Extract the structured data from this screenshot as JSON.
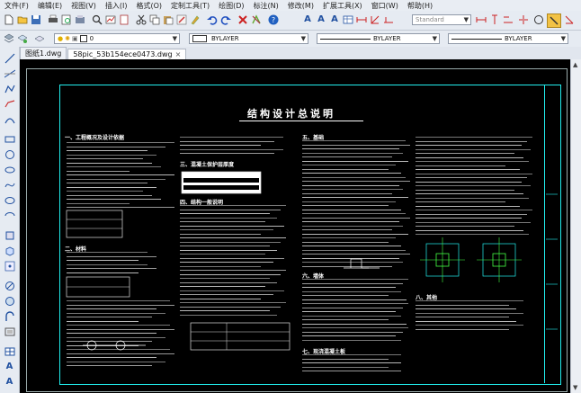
{
  "menu": [
    "文件(F)",
    "编辑(E)",
    "视图(V)",
    "插入(I)",
    "格式(O)",
    "定制工具(T)",
    "绘图(D)",
    "标注(N)",
    "修改(M)",
    "扩展工具(X)",
    "窗口(W)",
    "帮助(H)"
  ],
  "toolbar": {
    "text_style": "Standard",
    "layer_value": "0",
    "color_value": "BYLAYER",
    "linetype_value": "BYLAYER",
    "lineweight_value": "BYLAYER"
  },
  "tabs": [
    {
      "label": "图纸1.dwg"
    },
    {
      "label": "58pic_53b154ece0473.dwg"
    }
  ],
  "drawing": {
    "title": "结构设计总说明",
    "sections": [
      "一、工程概况及设计依据",
      "二、材料",
      "三、混凝土保护层厚度",
      "四、结构一般说明",
      "五、基础",
      "六、墙体",
      "七、现浇混凝土板",
      "八、其他"
    ]
  },
  "colors": {
    "frame": "#22eeee",
    "canvas_bg": "#000000",
    "text": "#ffffff"
  },
  "icons": {
    "toolbar1": [
      "new-file-icon",
      "open-folder-icon",
      "save-icon",
      "print-icon",
      "print-preview-icon",
      "publish-icon",
      "find-icon",
      "plot-icon",
      "cut-icon",
      "copy-icon",
      "paste-icon",
      "match-properties-icon",
      "brush-icon",
      "undo-icon",
      "redo-icon",
      "close-x-icon",
      "pan-icon",
      "help-icon",
      "text-style-icon",
      "text-style-icon",
      "text-style-icon",
      "table-style-icon",
      "dim-icon",
      "dim-icon",
      "dim-icon",
      "circle-icon",
      "ortho-icon",
      "snap-icon"
    ],
    "left": [
      "line-icon",
      "construction-line-icon",
      "polyline-icon",
      "polygon-icon",
      "arc-icon",
      "rectangle-icon",
      "circle-icon",
      "cloud-icon",
      "spline-icon",
      "ellipse-icon",
      "ellipse-arc-icon",
      "insert-block-icon",
      "make-block-icon",
      "point-icon",
      "hatch-icon",
      "region-icon",
      "table-icon",
      "mtext-icon",
      "text-icon"
    ]
  }
}
